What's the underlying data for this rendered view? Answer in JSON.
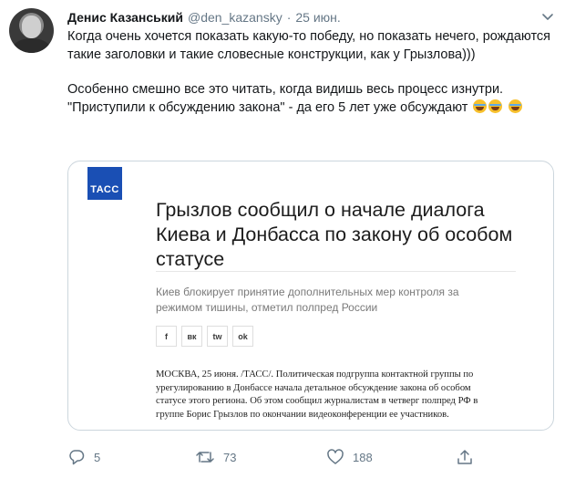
{
  "tweet": {
    "author_name": "Денис Казанський",
    "handle": "@den_kazansky",
    "separator": "·",
    "date": "25 июн.",
    "paragraph1": "Когда очень хочется показать какую-то победу, но показать нечего, рождаются такие заголовки и такие словесные конструкции, как у Грызлова)))",
    "paragraph2": "Особенно смешно все это читать, когда видишь весь процесс изнутри. \"Приступили к обсуждению закона\" - да его 5 лет уже обсуждают",
    "emoji": "face-with-tears-of-joy-icon"
  },
  "card": {
    "logo_text": "ТАСС",
    "headline": "Грызлов сообщил о начале диалога Киева и Донбасса по закону об особом статусе",
    "lead": "Киев блокирует принятие дополнительных мер контроля за режимом тишины, отметил полпред России",
    "share_buttons": [
      "f",
      "вк",
      "tw",
      "ok"
    ],
    "article_text": "МОСКВА, 25 июня. /ТАСС/. Политическая подгруппа контактной группы по урегулированию в Донбассе начала детальное обсуждение закона об особом статусе этого региона. Об этом сообщил журналистам в четверг полпред РФ в группе Борис Грызлов по окончании видеоконференции ее участников."
  },
  "actions": {
    "replies": "5",
    "retweets": "73",
    "likes": "188"
  },
  "colors": {
    "text": "#14171a",
    "secondary": "#657786",
    "border": "#ccd6dd",
    "tass_blue": "#1a4fb4"
  }
}
